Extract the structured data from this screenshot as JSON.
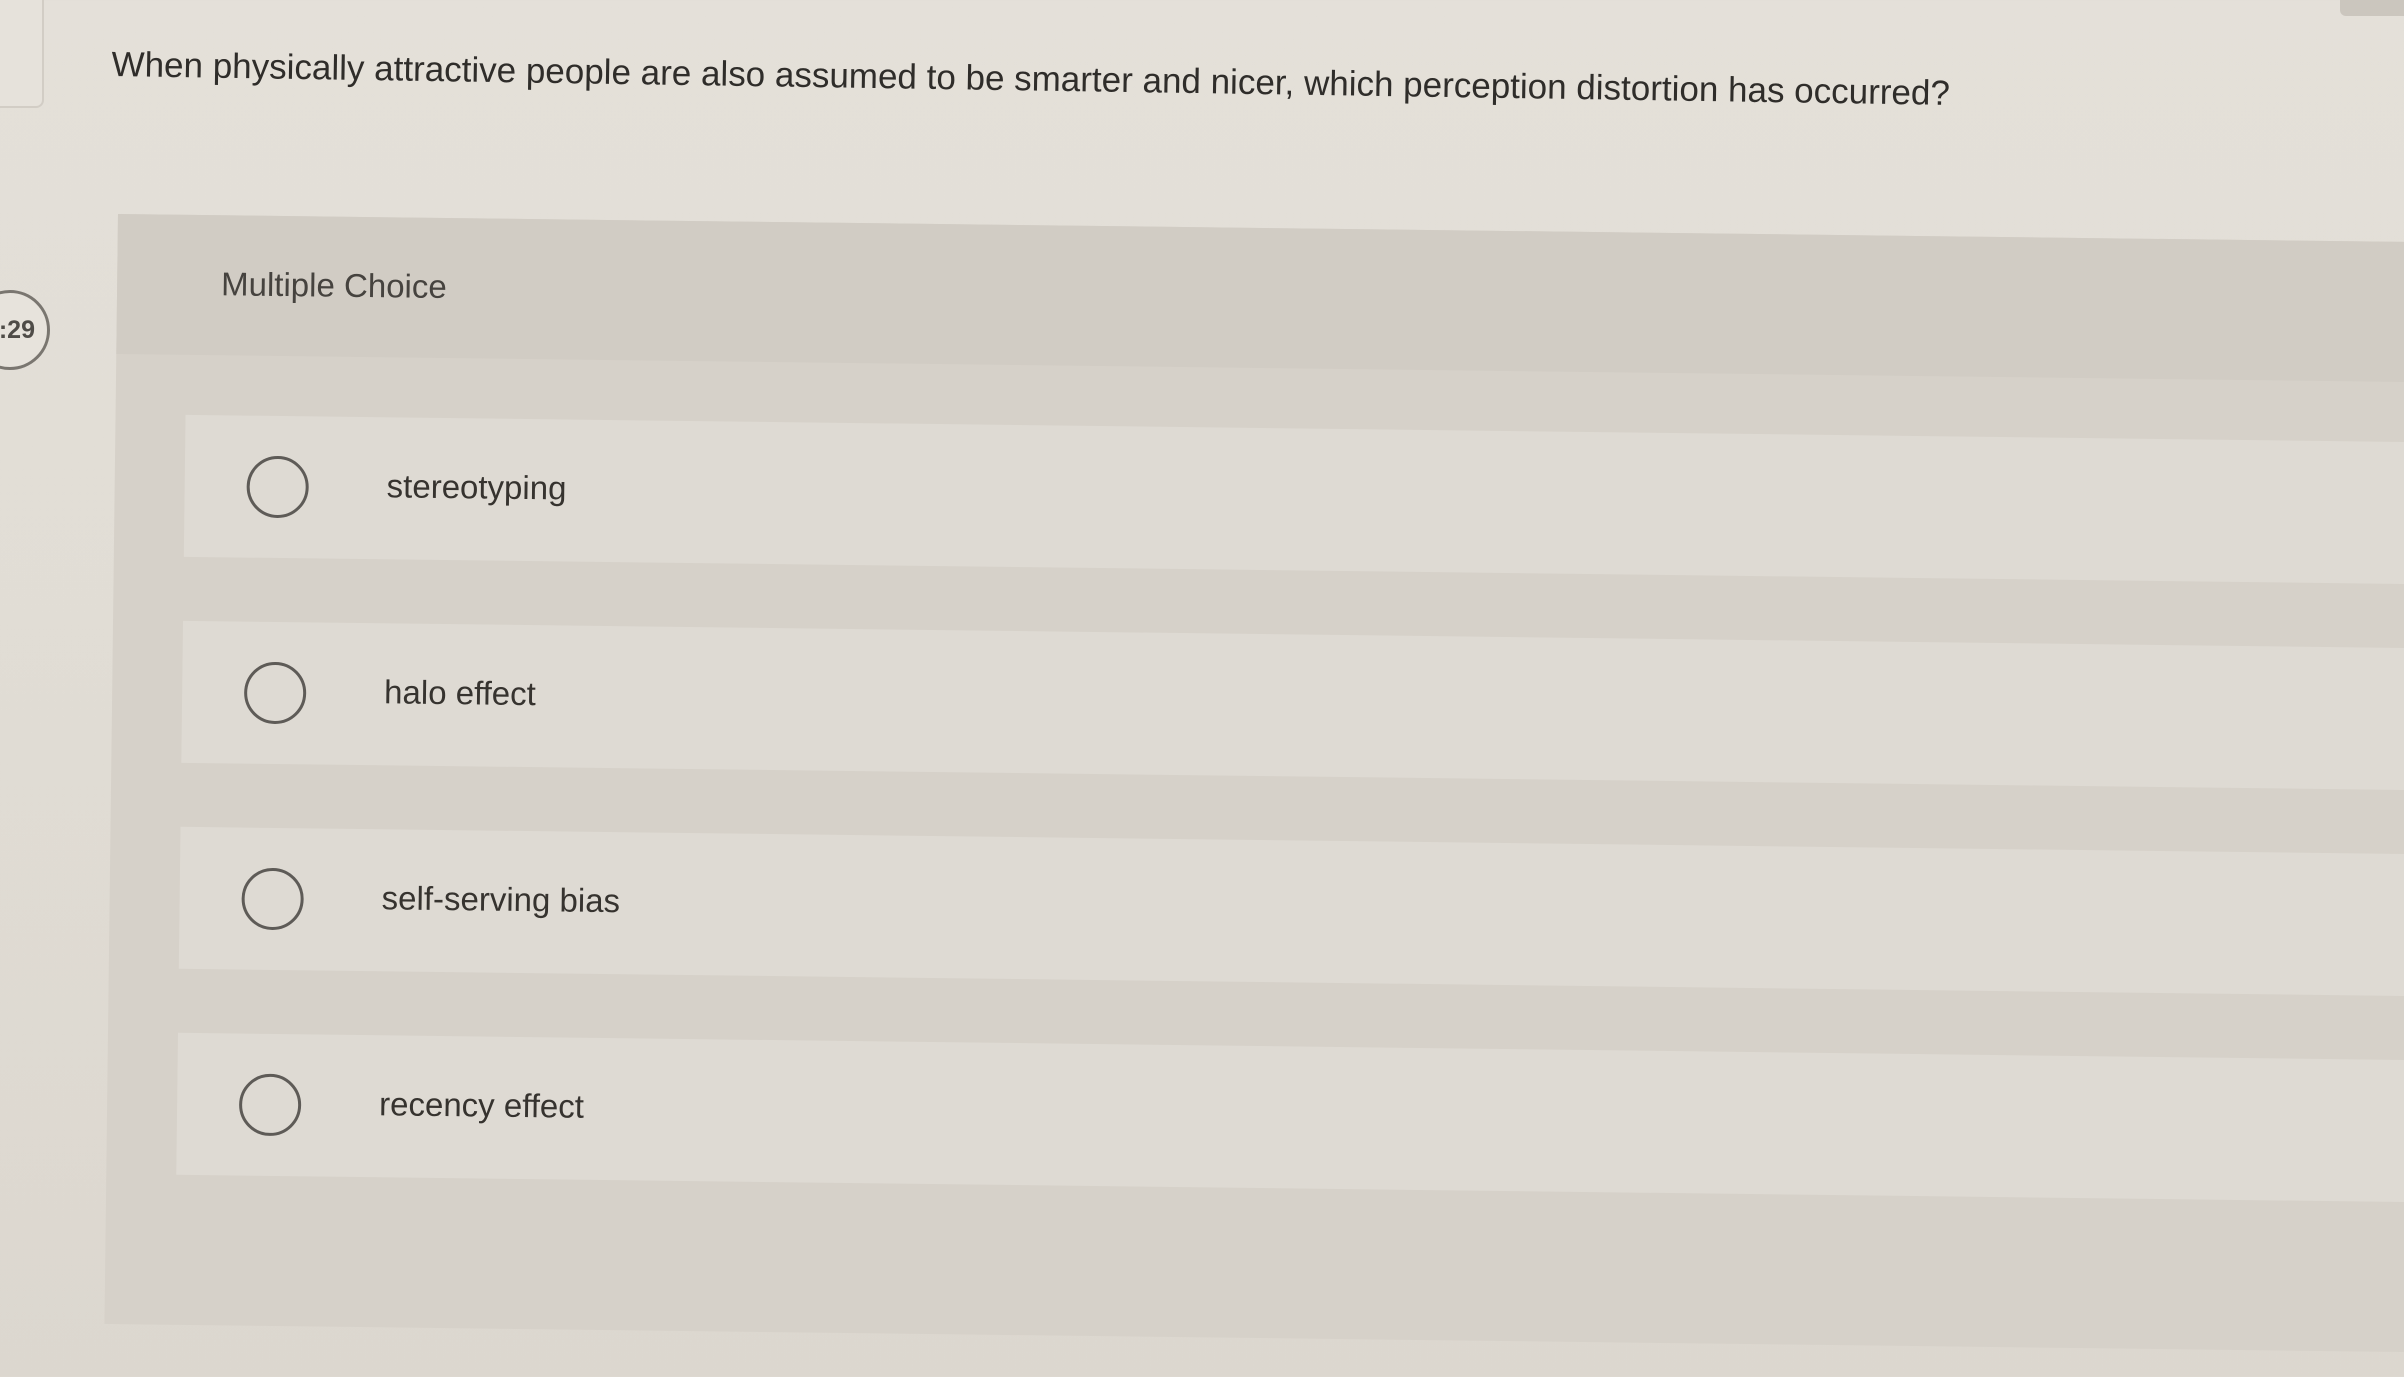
{
  "timer": {
    "label": ":29"
  },
  "question": {
    "text": "When physically attractive people are also assumed to be smarter and nicer, which perception distortion has occurred?"
  },
  "panel": {
    "title": "Multiple Choice"
  },
  "options": [
    {
      "label": "stereotyping",
      "selected": false
    },
    {
      "label": "halo effect",
      "selected": false
    },
    {
      "label": "self-serving bias",
      "selected": false
    },
    {
      "label": "recency effect",
      "selected": false
    }
  ]
}
